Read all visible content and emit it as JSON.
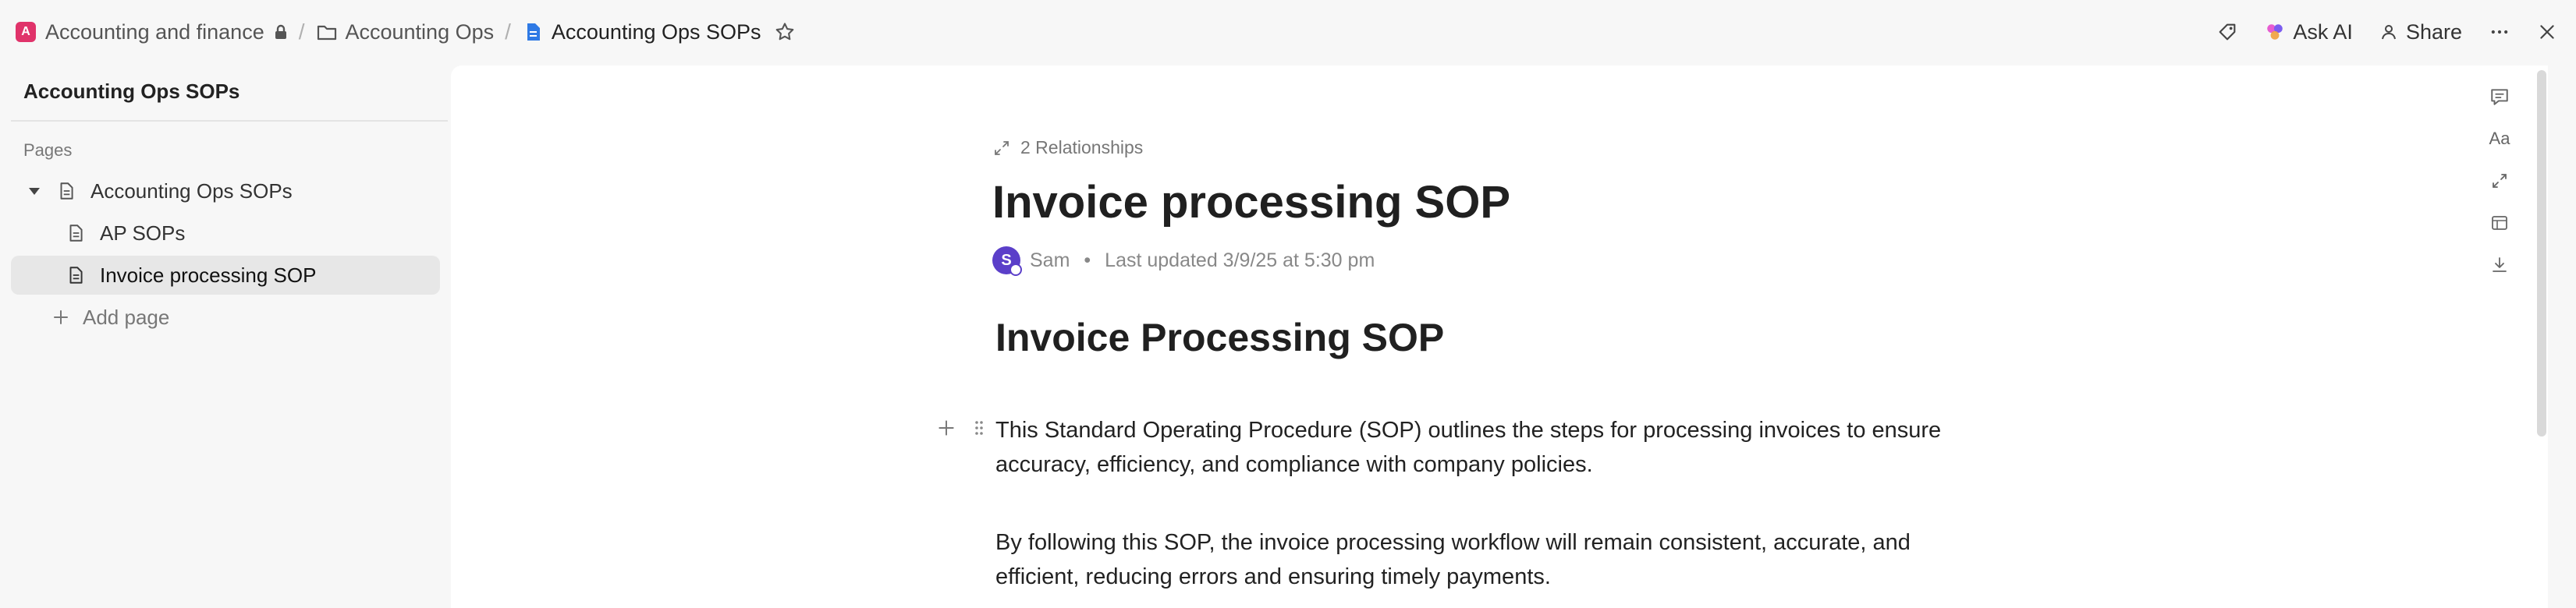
{
  "breadcrumb": {
    "workspace_badge": "A",
    "workspace": "Accounting and finance",
    "folder": "Accounting Ops",
    "doc": "Accounting Ops SOPs"
  },
  "toolbar": {
    "ask_ai": "Ask AI",
    "share": "Share"
  },
  "sidebar": {
    "title": "Accounting Ops SOPs",
    "section": "Pages",
    "items": [
      {
        "label": "Accounting Ops SOPs"
      },
      {
        "label": "AP SOPs"
      },
      {
        "label": "Invoice processing SOP"
      }
    ],
    "add_page": "Add page"
  },
  "doc": {
    "relationships": "2 Relationships",
    "title": "Invoice processing SOP",
    "author_initial": "S",
    "author": "Sam",
    "updated": "Last updated 3/9/25 at 5:30 pm",
    "heading": "Invoice Processing SOP",
    "para1_line1": "This Standard Operating Procedure (SOP) outlines the steps for processing invoices to ensure",
    "para1_line2": "accuracy, efficiency, and compliance with company policies.",
    "para2_line1": "By following this SOP, the invoice processing workflow will remain consistent, accurate, and",
    "para2_line2": "efficient, reducing errors and ensuring timely payments."
  },
  "right_icons": [
    "Aa"
  ],
  "colors": {
    "workspace_badge": "#e0336a",
    "avatar": "#5b3fc9",
    "doc_icon_blue": "#2f7ae5",
    "ask_ai_accent": "#e65cd1"
  }
}
